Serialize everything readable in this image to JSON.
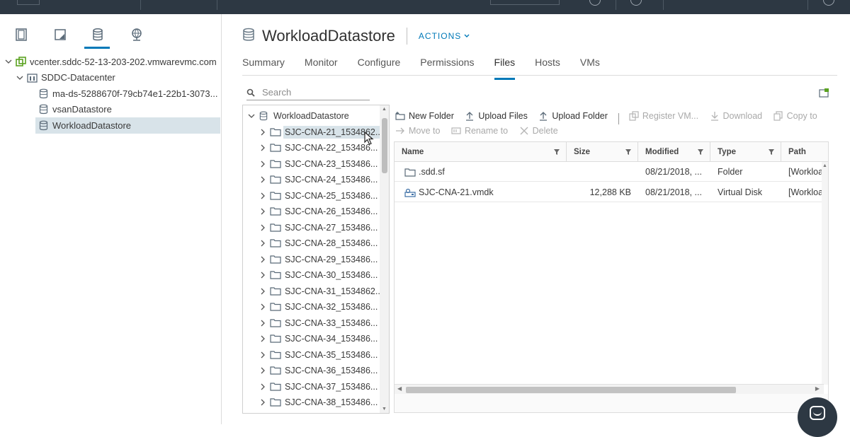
{
  "app": {
    "object_title": "WorkloadDatastore",
    "actions_label": "ACTIONS"
  },
  "nav_tabs": [
    {
      "icon": "hosts-clusters-icon"
    },
    {
      "icon": "vms-templates-icon"
    },
    {
      "icon": "storage-icon"
    },
    {
      "icon": "networking-icon"
    }
  ],
  "inventory": {
    "items": [
      {
        "label": "vcenter.sddc-52-13-203-202.vmwarevmc.com",
        "icon": "vcenter-icon"
      },
      {
        "label": "SDDC-Datacenter",
        "icon": "datacenter-icon"
      },
      {
        "label": "ma-ds-5288670f-79cb74e1-22b1-3073...",
        "icon": "datastore-icon"
      },
      {
        "label": "vsanDatastore",
        "icon": "datastore-icon"
      },
      {
        "label": "WorkloadDatastore",
        "icon": "datastore-icon"
      }
    ]
  },
  "tabs": [
    {
      "label": "Summary"
    },
    {
      "label": "Monitor"
    },
    {
      "label": "Configure"
    },
    {
      "label": "Permissions"
    },
    {
      "label": "Files"
    },
    {
      "label": "Hosts"
    },
    {
      "label": "VMs"
    }
  ],
  "search": {
    "placeholder": "Search"
  },
  "folder_tree": {
    "root": "WorkloadDatastore",
    "folders": [
      "SJC-CNA-21_1534862...",
      "SJC-CNA-22_153486...",
      "SJC-CNA-23_153486...",
      "SJC-CNA-24_153486...",
      "SJC-CNA-25_153486...",
      "SJC-CNA-26_153486...",
      "SJC-CNA-27_153486...",
      "SJC-CNA-28_153486...",
      "SJC-CNA-29_153486...",
      "SJC-CNA-30_153486...",
      "SJC-CNA-31_1534862...",
      "SJC-CNA-32_153486...",
      "SJC-CNA-33_153486...",
      "SJC-CNA-34_153486...",
      "SJC-CNA-35_153486...",
      "SJC-CNA-36_153486...",
      "SJC-CNA-37_153486...",
      "SJC-CNA-38_153486..."
    ]
  },
  "toolbar": {
    "new_folder": "New Folder",
    "upload_files": "Upload Files",
    "upload_folder": "Upload Folder",
    "register_vm": "Register VM...",
    "download": "Download",
    "copy_to": "Copy to",
    "move_to": "Move to",
    "rename_to": "Rename to",
    "delete": "Delete"
  },
  "grid": {
    "columns": [
      "Name",
      "Size",
      "Modified",
      "Type",
      "Path"
    ],
    "rows": [
      {
        "name": ".sdd.sf",
        "size": "",
        "modified": "08/21/2018, ...",
        "type": "Folder",
        "path": "[Workload",
        "icon": "folder-icon"
      },
      {
        "name": "SJC-CNA-21.vmdk",
        "size": "12,288 KB",
        "modified": "08/21/2018, ...",
        "type": "Virtual Disk",
        "path": "[Workload",
        "icon": "virtual-disk-icon"
      }
    ]
  },
  "colors": {
    "accent": "#0079b8",
    "header_bg": "#2d3843",
    "selection": "#d8e3e9"
  }
}
